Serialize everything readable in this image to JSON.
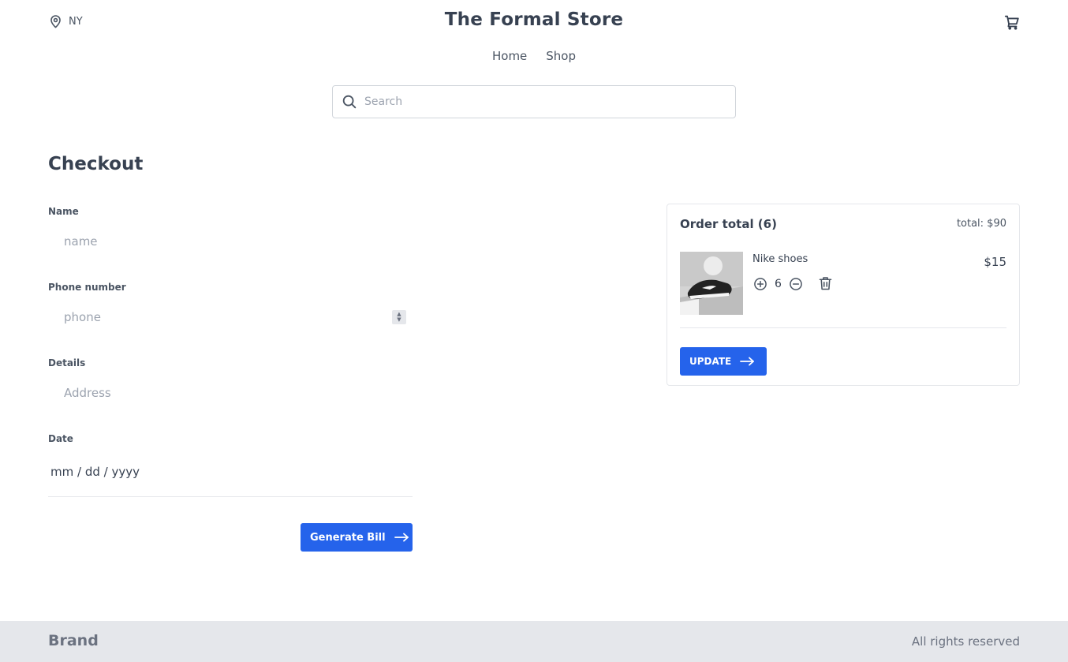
{
  "header": {
    "location": "NY",
    "title": "The Formal Store",
    "nav": [
      "Home",
      "Shop"
    ],
    "search_placeholder": "Search"
  },
  "checkout": {
    "title": "Checkout",
    "fields": {
      "name": {
        "label": "Name",
        "placeholder": "name"
      },
      "phone": {
        "label": "Phone number",
        "placeholder": "phone"
      },
      "details": {
        "label": "Details",
        "placeholder": "Address"
      },
      "date": {
        "label": "Date",
        "placeholder": "mm / dd / yyyy"
      }
    },
    "generate_label": "Generate Bill"
  },
  "order": {
    "title": "Order total (6)",
    "total": "total: $90",
    "items": [
      {
        "name": "Nike shoes",
        "quantity": "6",
        "price": "$15"
      }
    ],
    "update_label": "UPDATE"
  },
  "footer": {
    "brand": "Brand",
    "rights": "All rights reserved"
  },
  "colors": {
    "accent": "#2563eb",
    "text": "#374151",
    "footer_bg": "#e5e7eb"
  }
}
